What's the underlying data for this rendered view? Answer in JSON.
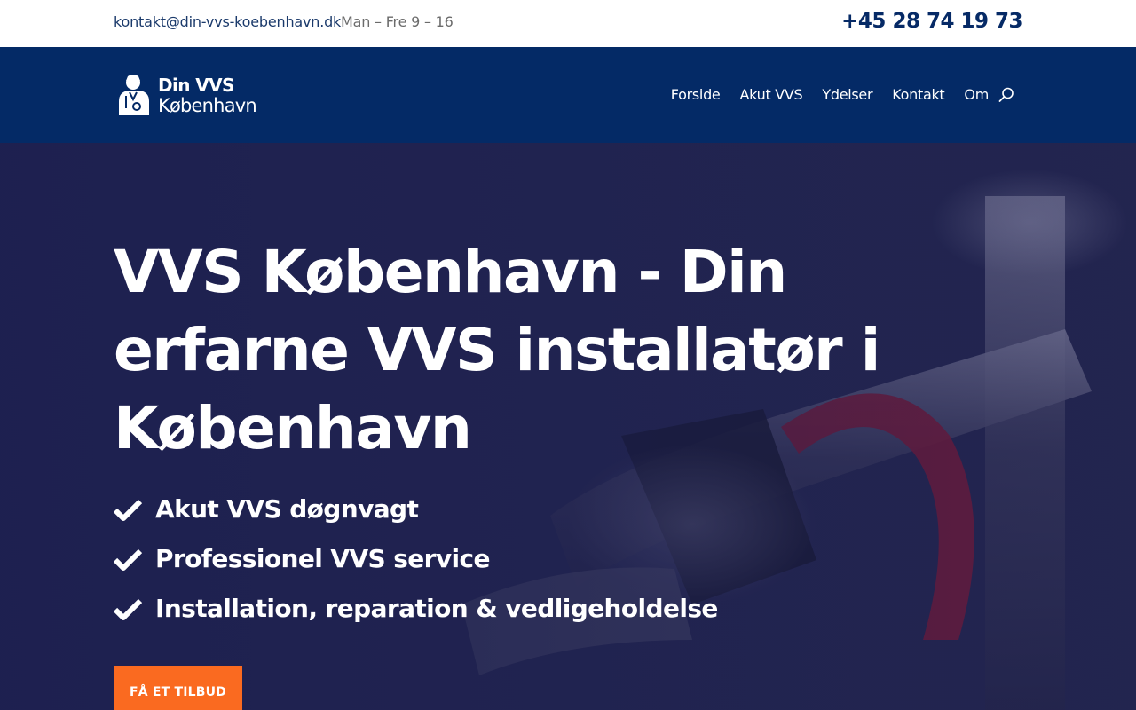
{
  "topbar": {
    "email": "kontakt@din-vvs-koebenhavn.dk",
    "hours": "Man – Fre 9 – 16",
    "phone": "+45 28 74 19 73"
  },
  "brand": {
    "line1": "Din VVS",
    "line2": "København"
  },
  "nav": {
    "items": [
      {
        "label": "Forside"
      },
      {
        "label": "Akut VVS"
      },
      {
        "label": "Ydelser"
      },
      {
        "label": "Kontakt"
      },
      {
        "label": "Om"
      }
    ],
    "search_icon": "search-icon"
  },
  "hero": {
    "title": "VVS København - Din erfarne VVS installatør i København",
    "features": [
      {
        "text": "Akut VVS døgnvagt",
        "icon": "check-icon"
      },
      {
        "text": "Professionel VVS service",
        "icon": "check-icon"
      },
      {
        "text": "Installation, reparation & vedligeholdelse",
        "icon": "check-icon"
      }
    ],
    "cta_label": "FÅ ET TILBUD"
  },
  "colors": {
    "topbar_bg": "#ffffff",
    "nav_bg": "#042a66",
    "hero_overlay": "#1d2050",
    "phone": "#062a66",
    "cta": "#fa6a20"
  }
}
